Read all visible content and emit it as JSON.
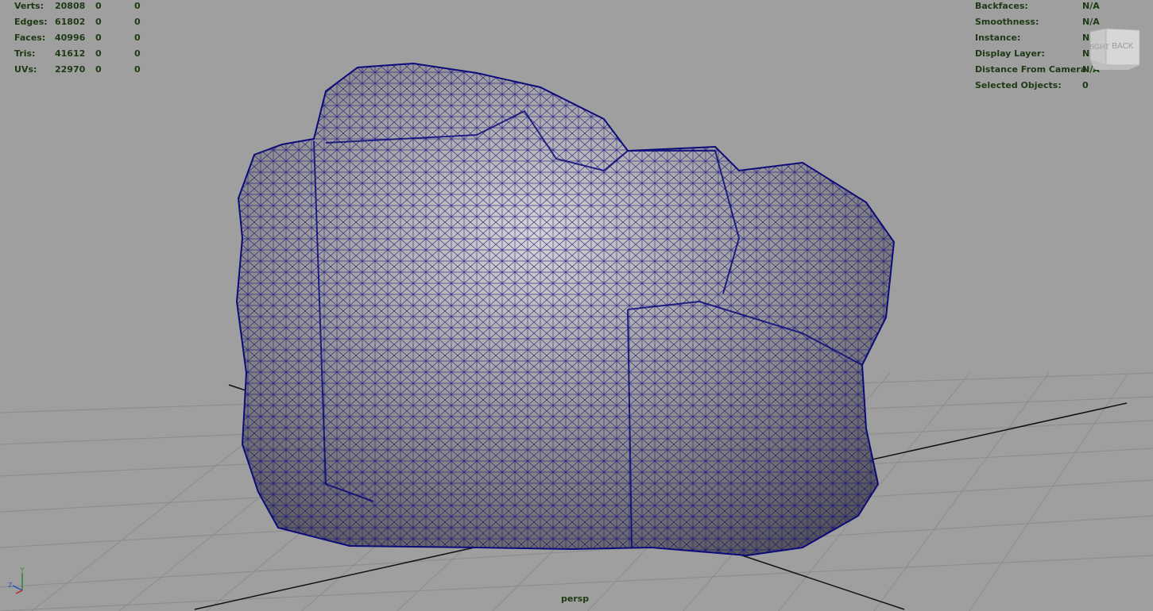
{
  "stats": {
    "rows": [
      {
        "label": "Verts:",
        "v1": "20808",
        "v2": "0",
        "v3": "0"
      },
      {
        "label": "Edges:",
        "v1": "61802",
        "v2": "0",
        "v3": "0"
      },
      {
        "label": "Faces:",
        "v1": "40996",
        "v2": "0",
        "v3": "0"
      },
      {
        "label": "Tris:",
        "v1": "41612",
        "v2": "0",
        "v3": "0"
      },
      {
        "label": "UVs:",
        "v1": "22970",
        "v2": "0",
        "v3": "0"
      }
    ]
  },
  "info": {
    "rows": [
      {
        "label": "Backfaces:",
        "value": "N/A"
      },
      {
        "label": "Smoothness:",
        "value": "N/A"
      },
      {
        "label": "Instance:",
        "value": "N/A"
      },
      {
        "label": "Display Layer:",
        "value": "N/A"
      },
      {
        "label": "Distance From Camera:",
        "value": "N/A"
      },
      {
        "label": "Selected Objects:",
        "value": "0"
      }
    ]
  },
  "viewcube": {
    "right_label": "RIGHT",
    "back_label": "BACK"
  },
  "axis": {
    "y_label": "Y",
    "z_label": "Z"
  },
  "camera": {
    "name": "persp"
  },
  "colors": {
    "background": "#9f9f9f",
    "grid": "#8a8a8a",
    "wire": "#0b0b7a",
    "hud_text": "#1d3a14"
  }
}
